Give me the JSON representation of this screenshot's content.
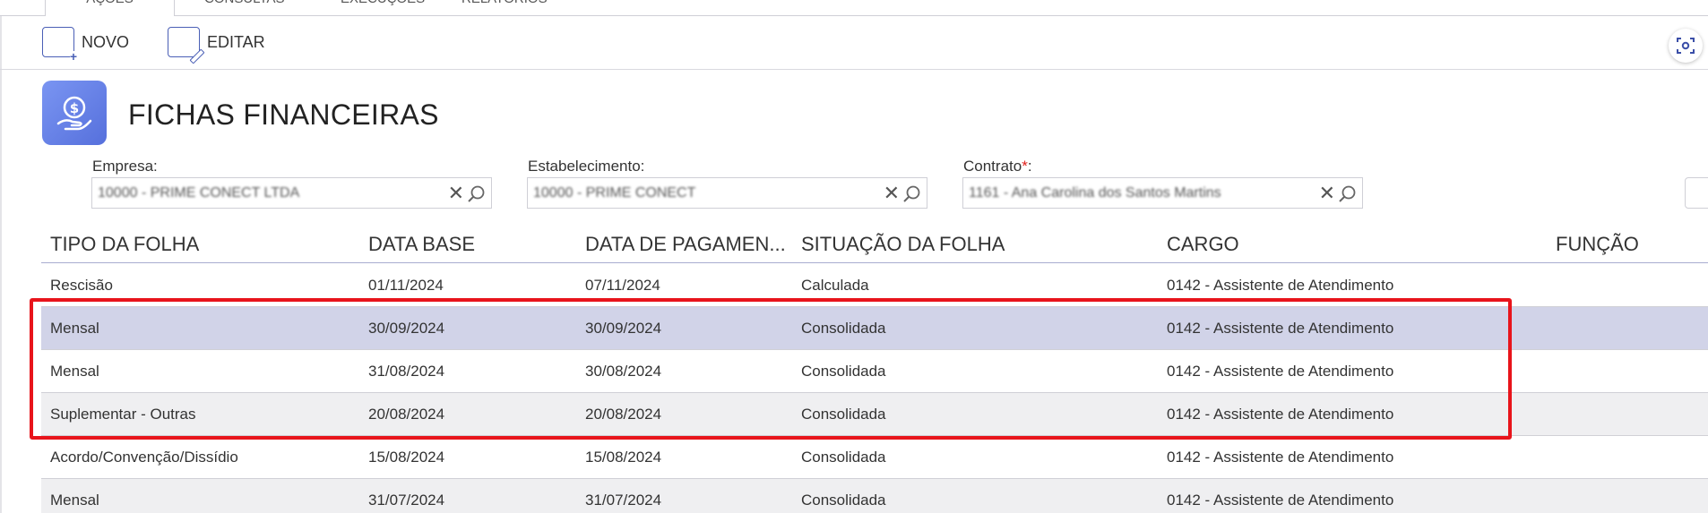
{
  "tabs": [
    "AÇÕES",
    "CONSULTAS",
    "EXECUÇÕES",
    "RELATÓRIOS"
  ],
  "toolbar": {
    "novo_label": "NOVO",
    "editar_label": "EDITAR"
  },
  "page": {
    "title": "FICHAS FINANCEIRAS"
  },
  "filters": {
    "empresa": {
      "label": "Empresa:",
      "value": "10000 - PRIME CONECT LTDA"
    },
    "estabelecimento": {
      "label": "Estabelecimento:",
      "value": "10000 - PRIME CONECT"
    },
    "contrato": {
      "label": "Contrato",
      "required_mark": "*",
      "suffix": ":",
      "value": "1161 - Ana Carolina dos Santos Martins"
    }
  },
  "table": {
    "columns": [
      "TIPO DA FOLHA",
      "DATA BASE",
      "DATA DE PAGAMEN...",
      "SITUAÇÃO DA FOLHA",
      "CARGO",
      "FUNÇÃO"
    ],
    "rows": [
      {
        "tipo": "Rescisão",
        "data_base": "01/11/2024",
        "data_pagamento": "07/11/2024",
        "situacao": "Calculada",
        "cargo": "0142 - Assistente de Atendimento",
        "funcao": ""
      },
      {
        "tipo": "Mensal",
        "data_base": "30/09/2024",
        "data_pagamento": "30/09/2024",
        "situacao": "Consolidada",
        "cargo": "0142 - Assistente de Atendimento",
        "funcao": ""
      },
      {
        "tipo": "Mensal",
        "data_base": "31/08/2024",
        "data_pagamento": "30/08/2024",
        "situacao": "Consolidada",
        "cargo": "0142 - Assistente de Atendimento",
        "funcao": ""
      },
      {
        "tipo": "Suplementar - Outras",
        "data_base": "20/08/2024",
        "data_pagamento": "20/08/2024",
        "situacao": "Consolidada",
        "cargo": "0142 - Assistente de Atendimento",
        "funcao": ""
      },
      {
        "tipo": "Acordo/Convenção/Dissídio",
        "data_base": "15/08/2024",
        "data_pagamento": "15/08/2024",
        "situacao": "Consolidada",
        "cargo": "0142 - Assistente de Atendimento",
        "funcao": ""
      },
      {
        "tipo": "Mensal",
        "data_base": "31/07/2024",
        "data_pagamento": "31/07/2024",
        "situacao": "Consolidada",
        "cargo": "0142 - Assistente de Atendimento",
        "funcao": ""
      }
    ]
  },
  "colors": {
    "accent": "#4a5fb6",
    "selected_row": "#d1d3e8",
    "alt_row": "#efeff1",
    "highlight_box": "#e8141b"
  }
}
